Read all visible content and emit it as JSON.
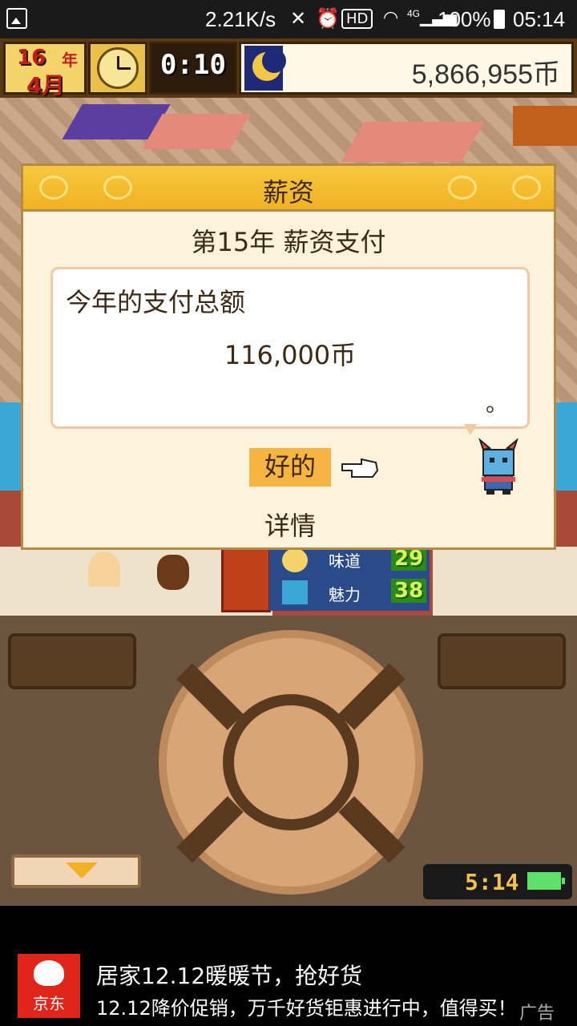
{
  "status_bar": {
    "network_speed": "2.21K/s",
    "hd_badge": "HD",
    "battery": "100%",
    "time": "05:14",
    "network_type": "4G"
  },
  "hud": {
    "year_number": "16",
    "year_unit": "年",
    "month": "4月",
    "game_time": "0:10",
    "money": "5,866,955币"
  },
  "dialog": {
    "title": "薪资",
    "subtitle": "第15年 薪资支付",
    "message_line1": "今年的支付总额",
    "message_amount": "116,000币",
    "message_end": "。",
    "ok_label": "好的",
    "details_label": "详情"
  },
  "stats": [
    {
      "label": "味道",
      "value": "29"
    },
    {
      "label": "魅力",
      "value": "38"
    }
  ],
  "device_clock": "5:14",
  "ad": {
    "logo_text": "京东",
    "title": "居家12.12暖暖节，抢好货",
    "description": "12.12降价促销，万千好货钜惠进行中，值得买！",
    "tag": "广告"
  },
  "colors": {
    "dialog_title_bar": "#f1b122",
    "dialog_bg": "#fdf2dc",
    "ok_button": "#f6b443",
    "ad_logo": "#e1251b"
  }
}
